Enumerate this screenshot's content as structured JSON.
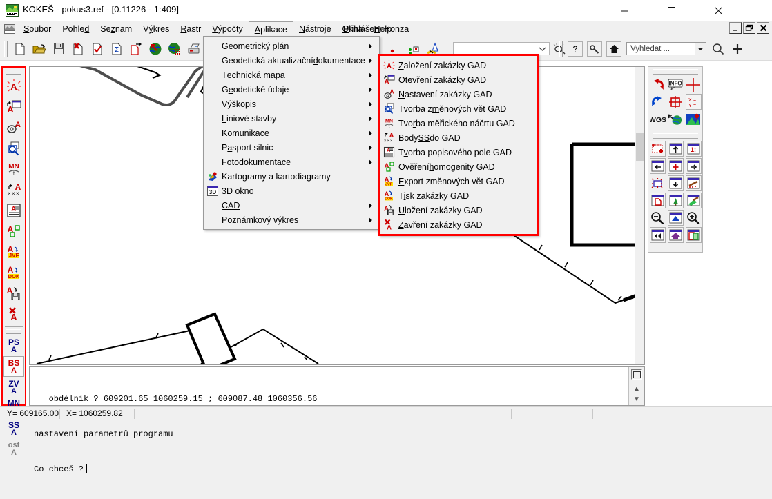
{
  "window": {
    "title": "KOKEŠ - pokus3.ref - [0.11226 - 1:409]",
    "icon": "kokes-app-icon",
    "minimize": "−",
    "maximize": "□",
    "close": "✕"
  },
  "mdi_buttons": {
    "minimize": "_",
    "restore": "❐",
    "close": "✕"
  },
  "menubar": {
    "items": [
      {
        "label": "Soubor",
        "pre": "S",
        "rest": "oubor",
        "active": false
      },
      {
        "label": "Pohled",
        "pre": "",
        "rest": "Pohled",
        "active": false
      },
      {
        "label": "Seznam",
        "pre": "",
        "rest": "Seznam",
        "active": false
      },
      {
        "label": "Výkres",
        "pre": "",
        "rest": "Výkres",
        "active": false
      },
      {
        "label": "Rastr",
        "pre": "R",
        "rest": "astr",
        "active": false
      },
      {
        "label": "Výpočty",
        "pre": "V",
        "rest": "ýpočty",
        "active": false
      },
      {
        "label": "Aplikace",
        "pre": "A",
        "rest": "plikace",
        "active": true
      },
      {
        "label": "Nástroje",
        "pre": "N",
        "rest": "ástroje",
        "active": false
      },
      {
        "label": "Okna",
        "pre": "O",
        "rest": "kna",
        "active": false
      },
      {
        "label": "Help",
        "pre": "H",
        "rest": "elp",
        "active": false
      }
    ],
    "login_status": "Přihlášen: Honza"
  },
  "toolbar": {
    "combo_value": "",
    "search_placeholder": "Vyhledat ...",
    "help_label": "?",
    "icons": [
      "new-file-icon",
      "open-folder-icon",
      "save-disk-icon",
      "delete-file-icon",
      "check-file-icon",
      "sum-file-icon",
      "export-file-icon",
      "globe-red-arrow-icon",
      "globe-grid-icon",
      "print-preview-icon",
      "print-icon",
      "points-green-icon",
      "draw-tool-icon",
      "settings-wrench-icon",
      "home-icon",
      "search-magnifier-icon",
      "add-plus-icon"
    ]
  },
  "left_toolbar": {
    "groups": [
      {
        "buttons": [
          {
            "name": "zalozeni-zakazky-gad",
            "label": "A",
            "style": "red-dashed"
          },
          {
            "name": "otevreni-zakazky-gad",
            "label": "A",
            "style": "red-open"
          },
          {
            "name": "nastaveni-zakazky-gad",
            "label": "A",
            "style": "gear"
          },
          {
            "name": "tvorba-zmenovych-vet-gad",
            "label": "",
            "style": "magnify"
          },
          {
            "name": "tvorba-mericiho-nacrtu-gad",
            "label": "MN",
            "style": "mn"
          },
          {
            "name": "body-ss-do-gad",
            "label": "A",
            "style": "points"
          },
          {
            "name": "tvorba-popisoveho-pole-gad",
            "label": "A",
            "style": "doc"
          },
          {
            "name": "overeni-homogenity-gad",
            "label": "A",
            "style": "homog"
          },
          {
            "name": "export-zmenovych-vet-gad",
            "label": "JVF",
            "style": "jvf"
          },
          {
            "name": "tisk-zakazky-gad",
            "label": "DOK",
            "style": "dok"
          },
          {
            "name": "ulozeni-zakazky-gad",
            "label": "A",
            "style": "savea"
          },
          {
            "name": "zavreni-zakazky-gad",
            "label": "A",
            "style": "closea"
          }
        ]
      },
      {
        "buttons": [
          {
            "name": "layer-ps",
            "label": "PS",
            "sub": "A",
            "color": "#000080",
            "selected": false
          },
          {
            "name": "layer-bs",
            "label": "BS",
            "sub": "A",
            "color": "#cc0000",
            "selected": true
          },
          {
            "name": "layer-zv",
            "label": "ZV",
            "sub": "A",
            "color": "#000080",
            "selected": false
          },
          {
            "name": "layer-mn",
            "label": "MN",
            "sub": "A",
            "color": "#000080",
            "selected": false
          },
          {
            "name": "layer-ss",
            "label": "SS",
            "sub": "A",
            "color": "#000080",
            "selected": false
          },
          {
            "name": "layer-ost",
            "label": "ost",
            "sub": "A",
            "color": "#808080",
            "selected": false
          }
        ]
      }
    ]
  },
  "right_panel": {
    "rows": [
      [
        "undo-arrow-icon",
        "info-icon",
        "crosshair-icon"
      ],
      [
        "redo-arrow-icon",
        "target-red-icon",
        "xy-coords-icon"
      ],
      [
        "wgs-icon",
        "globe-pin-icon",
        "map-marker-icon"
      ]
    ],
    "view_rows": [
      [
        "zoom-window-icon",
        "pan-up-icon",
        "scale-ratio-icon"
      ],
      [
        "pan-left-icon",
        "center-icon",
        "pan-right-icon"
      ],
      [
        "zoom-extents-icon",
        "pan-down-icon",
        "measure-icon"
      ],
      [
        "new-view-icon",
        "tree-layer-icon",
        "paint-layer-icon"
      ],
      [
        "zoom-out-icon",
        "zoom-fit-icon",
        "zoom-in-icon"
      ],
      [
        "rewind-icon",
        "home-view-icon",
        "copy-view-icon"
      ]
    ]
  },
  "applications_menu": {
    "items": [
      {
        "label": "Geometrický plán",
        "pre": "",
        "acc": "G",
        "post": "eometrický plán",
        "arrow": true,
        "icon": null
      },
      {
        "label": "Geodetická aktualizační dokumentace",
        "pre": "Geodetická aktualizační ",
        "acc": "d",
        "post": "okumentace",
        "arrow": true,
        "icon": null
      },
      {
        "label": "Technická mapa",
        "pre": "",
        "acc": "T",
        "post": "echnická mapa",
        "arrow": true,
        "icon": null
      },
      {
        "label": "Geodetické údaje",
        "pre": "G",
        "acc": "e",
        "post": "odetické údaje",
        "arrow": true,
        "icon": null
      },
      {
        "label": "Výškopis",
        "pre": "",
        "acc": "V",
        "post": "ýškopis",
        "arrow": true,
        "icon": null
      },
      {
        "label": "Liniové stavby",
        "pre": "",
        "acc": "L",
        "post": "iniové stavby",
        "arrow": true,
        "icon": null
      },
      {
        "label": "Komunikace",
        "pre": "",
        "acc": "K",
        "post": "omunikace",
        "arrow": true,
        "icon": null
      },
      {
        "label": "Pasport silnic",
        "pre": "P",
        "acc": "a",
        "post": "sport silnic",
        "arrow": true,
        "icon": null
      },
      {
        "label": "Fotodokumentace",
        "pre": "",
        "acc": "F",
        "post": "otodokumentace",
        "arrow": true,
        "icon": null
      },
      {
        "label": "Kartogramy a kartodiagramy",
        "pre": "Kartogramy a kartodiagramy",
        "acc": "",
        "post": "",
        "arrow": false,
        "icon": "kartogram-icon"
      },
      {
        "label": "3D okno",
        "pre": "3D okno",
        "acc": "",
        "post": "",
        "arrow": false,
        "icon": "3d-window-icon"
      },
      {
        "label": "CAD",
        "pre": "",
        "acc": "CAD",
        "post": "",
        "arrow": true,
        "icon": null
      },
      {
        "label": "Poznámkový výkres",
        "pre": "Poznámkový výkres",
        "acc": "",
        "post": "",
        "arrow": false,
        "icon": null
      }
    ]
  },
  "gad_submenu": {
    "items": [
      {
        "label": "Založení zakázky GAD",
        "pre": "",
        "acc": "Z",
        "post": "aložení zakázky GAD",
        "icon": "new-gad-icon"
      },
      {
        "label": "Otevření zakázky GAD",
        "pre": "",
        "acc": "O",
        "post": "tevření zakázky GAD",
        "icon": "open-gad-icon"
      },
      {
        "label": "Nastavení zakázky GAD",
        "pre": "",
        "acc": "N",
        "post": "astavení zakázky GAD",
        "icon": "settings-gad-icon"
      },
      {
        "label": "Tvorba změnových vět GAD",
        "pre": "Tvorba z",
        "acc": "m",
        "post": "ěnových vět GAD",
        "icon": "changes-gad-icon"
      },
      {
        "label": "Tvorba měřického náčrtu GAD",
        "pre": "Tvo",
        "acc": "r",
        "post": "ba měřického náčrtu GAD",
        "icon": "sketch-gad-icon"
      },
      {
        "label": "Body SS do GAD",
        "pre": "Body ",
        "acc": "SS",
        "post": " do GAD",
        "icon": "points-gad-icon"
      },
      {
        "label": "Tvorba popisového pole GAD",
        "pre": "T",
        "acc": "v",
        "post": "orba popisového pole GAD",
        "icon": "titleblock-gad-icon"
      },
      {
        "label": "Ověření homogenity GAD",
        "pre": "Ověření ",
        "acc": "h",
        "post": "omogenity GAD",
        "icon": "homogenity-gad-icon"
      },
      {
        "label": "Export změnových vět GAD",
        "pre": "",
        "acc": "E",
        "post": "xport změnových vět GAD",
        "icon": "export-jvf-gad-icon"
      },
      {
        "label": "Tisk zakázky GAD",
        "pre": "T",
        "acc": "i",
        "post": "sk zakázky GAD",
        "icon": "print-dok-gad-icon"
      },
      {
        "label": "Uložení zakázky GAD",
        "pre": "",
        "acc": "U",
        "post": "ložení zakázky GAD",
        "icon": "save-gad-icon"
      },
      {
        "label": "Zavření zakázky GAD",
        "pre": "",
        "acc": "Z",
        "post": "avření zakázky GAD",
        "icon": "close-gad-icon"
      }
    ]
  },
  "console": {
    "line1": "   obdélník ? 609201.65 1060259.15 ; 609087.48 1060356.56",
    "line2": "nastavení parametrů programu",
    "line3": "Co chceš ?"
  },
  "statusbar": {
    "y_label": "Y=  609165.00",
    "x_label": "X=  1060259.82"
  },
  "colors": {
    "highlight_red": "#ff0000",
    "menu_bg": "#f0f0f0",
    "canvas_bg": "#ffffff",
    "accent_blue": "#000080"
  }
}
